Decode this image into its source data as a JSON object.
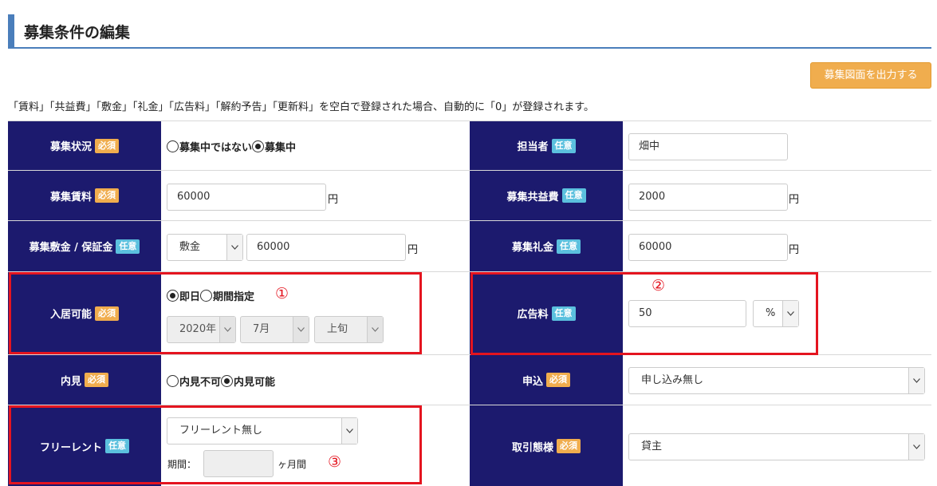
{
  "page": {
    "title": "募集条件の編集",
    "export_button": "募集図面を出力する",
    "notice": "「賃料」「共益費」「敷金」「礼金」「広告料」「解約予告」「更新料」を空白で登録された場合、自動的に「0」が登録されます。"
  },
  "badges": {
    "required": "必須",
    "optional": "任意"
  },
  "rows": {
    "status": {
      "label": "募集状況",
      "options": [
        {
          "label": "募集中ではない",
          "selected": false
        },
        {
          "label": "募集中",
          "selected": true
        }
      ]
    },
    "person": {
      "label": "担当者",
      "value": "畑中"
    },
    "rent": {
      "label": "募集賃料",
      "value": "60000",
      "unit": "円"
    },
    "common_fee": {
      "label": "募集共益費",
      "value": "2000",
      "unit": "円"
    },
    "deposit": {
      "label": "募集敷金 / 保証金",
      "type": "敷金",
      "value": "60000",
      "unit": "円"
    },
    "key_money": {
      "label": "募集礼金",
      "value": "60000",
      "unit": "円"
    },
    "move_in": {
      "label": "入居可能",
      "options": [
        {
          "label": "即日",
          "selected": true
        },
        {
          "label": "期間指定",
          "selected": false
        }
      ],
      "year": "2020年",
      "month": "7月",
      "period": "上旬",
      "marker": "①"
    },
    "ad_fee": {
      "label": "広告料",
      "value": "50",
      "unit_select": "%",
      "marker": "②"
    },
    "viewing": {
      "label": "内見",
      "options": [
        {
          "label": "内見不可",
          "selected": false
        },
        {
          "label": "内見可能",
          "selected": true
        }
      ]
    },
    "application": {
      "label": "申込",
      "value": "申し込み無し"
    },
    "free_rent": {
      "label": "フリーレント",
      "value": "フリーレント無し",
      "period_label": "期間：",
      "period_value": "",
      "period_unit": "ヶ月間",
      "marker": "③"
    },
    "transaction": {
      "label": "取引態様",
      "value": "貸主"
    }
  },
  "colors": {
    "label_bg": "#1c1a6e",
    "required_badge": "#f0ad4e",
    "optional_badge": "#5bc0de",
    "export_button": "#f0ad4e",
    "annotation": "#e4141f",
    "title_accent": "#4a7ebb"
  }
}
